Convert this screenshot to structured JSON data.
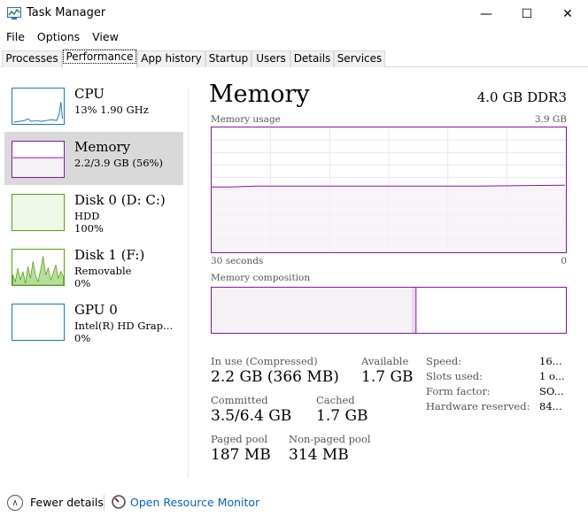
{
  "window": {
    "title": "Task Manager",
    "minimize": "—",
    "maximize": "☐",
    "close": "✕"
  },
  "menu": [
    "File",
    "Options",
    "View"
  ],
  "tabs": [
    "Processes",
    "Performance",
    "App history",
    "Startup",
    "Users",
    "Details",
    "Services"
  ],
  "active_tab": "Performance",
  "sidebar": {
    "items": [
      {
        "name": "CPU",
        "sub1": "13%  1.90 GHz",
        "sub2": ""
      },
      {
        "name": "Memory",
        "sub1": "2.2/3.9 GB (56%)",
        "sub2": ""
      },
      {
        "name": "Disk 0 (D: C:)",
        "sub1": "HDD",
        "sub2": "100%"
      },
      {
        "name": "Disk 1 (F:)",
        "sub1": "Removable",
        "sub2": "0%"
      },
      {
        "name": "GPU 0",
        "sub1": "Intel(R) HD Grap...",
        "sub2": "0%"
      }
    ],
    "selected": 1
  },
  "main": {
    "title": "Memory",
    "spec": "4.0 GB DDR3",
    "usage_label": "Memory usage",
    "usage_max": "3.9 GB",
    "time_left": "30 seconds",
    "time_right": "0",
    "composition_label": "Memory composition",
    "usage_level": 0.53,
    "composition": {
      "in_use": 0.565,
      "modified": 0.012
    }
  },
  "stats": {
    "in_use_label": "In use (Compressed)",
    "in_use_value": "2.2 GB (366 MB)",
    "available_label": "Available",
    "available_value": "1.7 GB",
    "committed_label": "Committed",
    "committed_value": "3.5/6.4 GB",
    "cached_label": "Cached",
    "cached_value": "1.7 GB",
    "paged_label": "Paged pool",
    "paged_value": "187 MB",
    "nonpaged_label": "Non-paged pool",
    "nonpaged_value": "314 MB"
  },
  "specs": {
    "speed_label": "Speed:",
    "speed_value": "16...",
    "slots_label": "Slots used:",
    "slots_value": "1 o...",
    "form_label": "Form factor:",
    "form_value": "SO...",
    "reserved_label": "Hardware reserved:",
    "reserved_value": "84..."
  },
  "footer": {
    "fewer_details": "Fewer details",
    "fewer_icon": "∧",
    "resource_monitor": "Open Resource Monitor"
  },
  "colors": {
    "memory": "#8b12ae",
    "cpu": "#117dbb",
    "disk": "#4da60c",
    "gpu": "#117dbb",
    "link": "#0066cc"
  }
}
